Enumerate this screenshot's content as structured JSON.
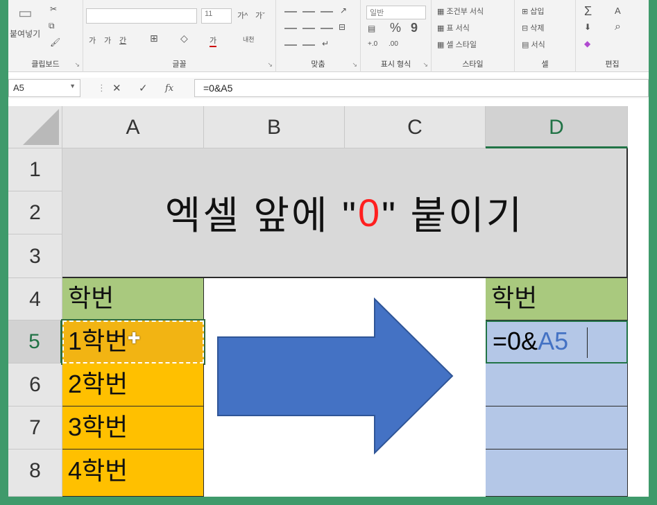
{
  "ribbon": {
    "clipboard": {
      "paste_label": "붙여넣기",
      "group_label": "클립보드"
    },
    "font": {
      "font_name": "",
      "font_size": "11",
      "grow_label": "가^",
      "shrink_label": "가ˇ",
      "bold_label": "가",
      "italic_label": "가",
      "underline_label": "간",
      "border_label": "⊞",
      "fill_label": "◇",
      "color_label": "가",
      "phonetic_label": "내천",
      "group_label": "글꼴"
    },
    "alignment": {
      "group_label": "맞춤"
    },
    "number": {
      "format_value": "일반",
      "percent_label": "%",
      "comma_label": "9",
      "group_label": "표시 형식"
    },
    "styles": {
      "conditional_label": "조건부 서식",
      "table_label": "표 서식",
      "cell_styles_label": "셀 스타일",
      "group_label": "스타일"
    },
    "cells": {
      "insert_label": "삽입",
      "delete_label": "삭제",
      "format_label": "서식",
      "group_label": "셀"
    },
    "editing": {
      "sum_label": "Σ",
      "fill_label": "⬇",
      "clear_label": "◆",
      "sort_label": "A",
      "find_label": "⌕",
      "group_label": "편집"
    }
  },
  "formula_bar": {
    "name_box": "A5",
    "cancel_label": "✕",
    "enter_label": "✓",
    "fx_label": "fx",
    "formula": "=0&A5"
  },
  "columns": [
    "A",
    "B",
    "C",
    "D"
  ],
  "rows": [
    "1",
    "2",
    "3",
    "4",
    "5",
    "6",
    "7",
    "8"
  ],
  "title": {
    "before": "엑셀 앞에 \"",
    "zero": "0",
    "after": "\" 붙이기"
  },
  "cells": {
    "a4": "학번",
    "a5": "1학번",
    "a6": "2학번",
    "a7": "3학번",
    "a8": "4학번",
    "d4": "학번",
    "d5_prefix": "=0&",
    "d5_ref": "A5"
  },
  "colors": {
    "accent_green": "#217346",
    "header_green": "#a9c97e",
    "orange": "#ffc000",
    "light_blue": "#b4c7e7",
    "arrow_blue": "#4472c4",
    "title_zero": "#ff1f1f",
    "frame": "#3f9a6b"
  }
}
